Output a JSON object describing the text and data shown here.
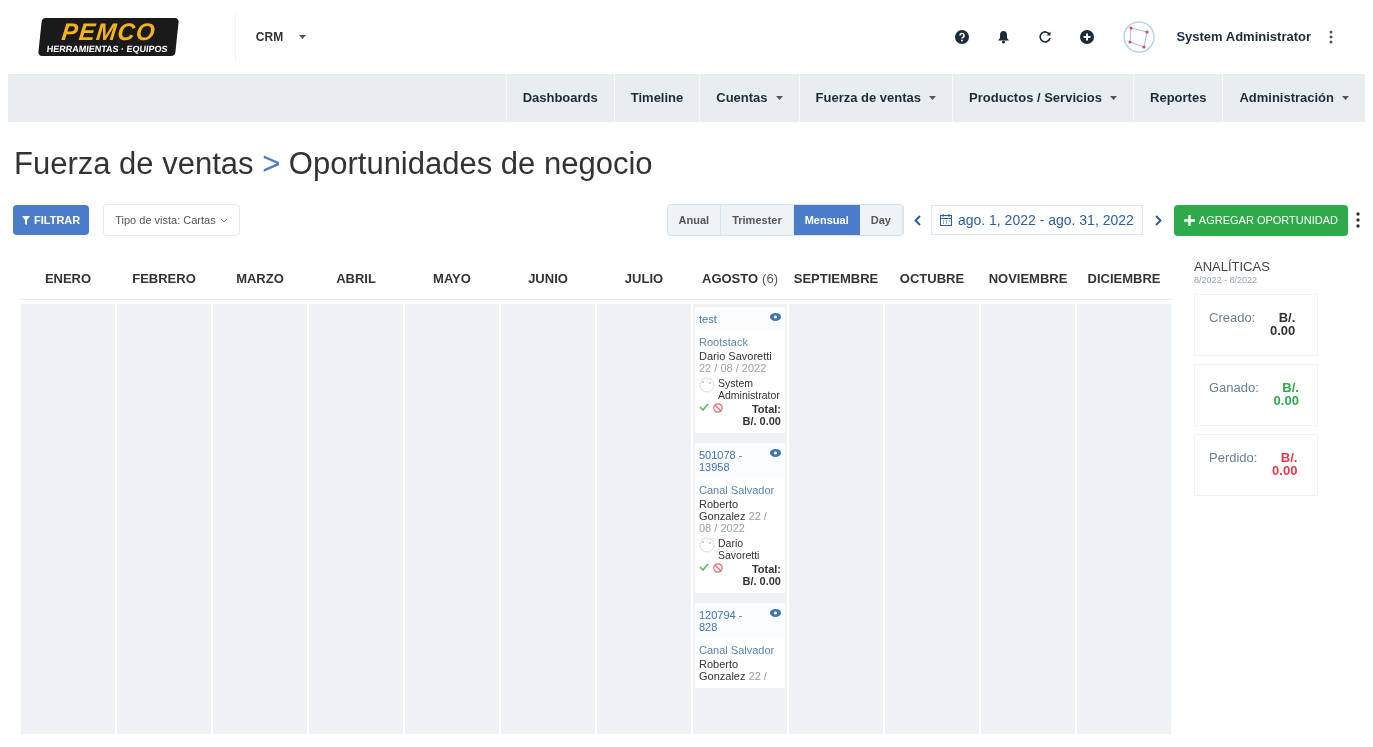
{
  "header": {
    "logo": {
      "name": "PEMCO",
      "tagline": "HERRAMIENTAS · EQUIPOS"
    },
    "app_switcher": "CRM",
    "user": "System Administrator"
  },
  "nav": [
    {
      "label": "Dashboards",
      "dropdown": false
    },
    {
      "label": "Timeline",
      "dropdown": false
    },
    {
      "label": "Cuentas",
      "dropdown": true
    },
    {
      "label": "Fuerza de ventas",
      "dropdown": true
    },
    {
      "label": "Productos / Servicios",
      "dropdown": true
    },
    {
      "label": "Reportes",
      "dropdown": false
    },
    {
      "label": "Administración",
      "dropdown": true
    }
  ],
  "breadcrumb": {
    "section": "Fuerza de ventas",
    "separator": ">",
    "page": "Oportunidades de negocio"
  },
  "toolbar": {
    "filter_button": "FILTRAR",
    "view_select": "Tipo de vista: Cartas",
    "periods": [
      {
        "label": "Anual",
        "selected": false
      },
      {
        "label": "Trimester",
        "selected": false
      },
      {
        "label": "Mensual",
        "selected": true
      },
      {
        "label": "Day",
        "selected": false
      }
    ],
    "date_range": "ago. 1, 2022 - ago. 31, 2022",
    "add_button": "AGREGAR OPORTUNIDAD"
  },
  "months": [
    {
      "name": "ENERO"
    },
    {
      "name": "FEBRERO"
    },
    {
      "name": "MARZO"
    },
    {
      "name": "ABRIL"
    },
    {
      "name": "MAYO"
    },
    {
      "name": "JUNIO"
    },
    {
      "name": "JULIO"
    },
    {
      "name": "AGOSTO",
      "count": "(6)",
      "cards": [
        {
          "title": "test",
          "company": "Rootstack",
          "contact": "Dario Savoretti",
          "date": "22 / 08 / 2022",
          "assignee": "System Administrator",
          "total_label": "Total:",
          "total": "B/. 0.00"
        },
        {
          "title": "501078 - 13958",
          "company": "Canal Salvador",
          "contact": "Roberto Gonzalez",
          "date": "22 / 08 / 2022",
          "assignee": "Dario Savoretti",
          "total_label": "Total:",
          "total": "B/. 0.00"
        },
        {
          "title": "120794 - 828",
          "company": "Canal Salvador",
          "contact": "Roberto Gonzalez",
          "date": "22 /"
        }
      ]
    },
    {
      "name": "SEPTIEMBRE"
    },
    {
      "name": "OCTUBRE"
    },
    {
      "name": "NOVIEMBRE"
    },
    {
      "name": "DICIEMBRE"
    }
  ],
  "analytics": {
    "title": "ANALÍTICAS",
    "period": "8/2022 - 8/2022",
    "items": [
      {
        "label": "Creado:",
        "value": "B/. 0.00",
        "kind": "created"
      },
      {
        "label": "Ganado:",
        "value": "B/. 0.00",
        "kind": "won"
      },
      {
        "label": "Perdido:",
        "value": "B/. 0.00",
        "kind": "lost"
      }
    ]
  }
}
